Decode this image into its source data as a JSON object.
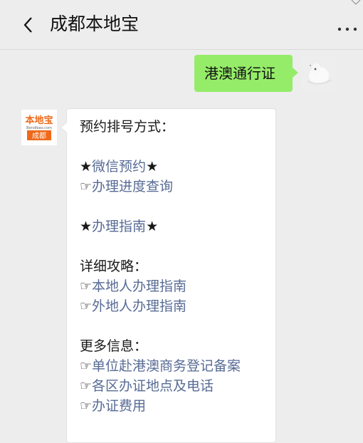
{
  "header": {
    "title": "成都本地宝",
    "back_icon": "chevron-left-icon",
    "more_icon": "ellipsis-icon"
  },
  "user_message": {
    "text": "港澳通行证",
    "avatar": "user-avatar-photo"
  },
  "bot_avatar": {
    "logo_text_top": "本地宝",
    "logo_domain": "Bendibao.com",
    "logo_city": "成都"
  },
  "bot_message": {
    "section1_title": "预约排号方式：",
    "wechat_booking_prefix": "★",
    "wechat_booking": "微信预约",
    "wechat_booking_suffix": "★",
    "hand_icon": "☞",
    "progress_query": "办理进度查询",
    "guide_prefix": "★",
    "guide": "办理指南",
    "guide_suffix": "★",
    "section2_title": "详细攻略：",
    "local_guide": "本地人办理指南",
    "nonlocal_guide": "外地人办理指南",
    "section3_title": "更多信息：",
    "business_registration": "单位赴港澳商务登记备案",
    "district_locations": "各区办证地点及电话",
    "fees": "办证费用"
  },
  "colors": {
    "background": "#ededed",
    "user_bubble": "#95ec69",
    "link": "#576b95",
    "logo_orange": "#ee6a1a"
  }
}
